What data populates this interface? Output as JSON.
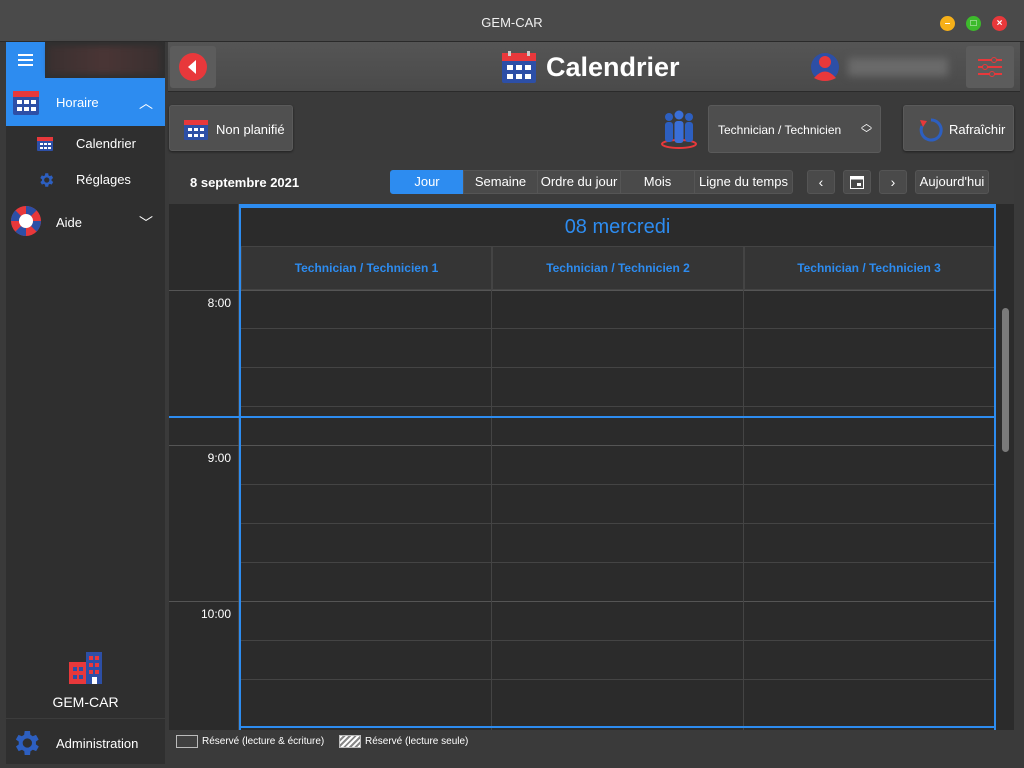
{
  "window": {
    "title": "GEM-CAR"
  },
  "sidebar": {
    "items": [
      {
        "label": "Horaire",
        "icon": "calendar-icon",
        "expanded": true
      },
      {
        "label": "Calendrier",
        "icon": "calendar-icon"
      },
      {
        "label": "Réglages",
        "icon": "gear-icon"
      },
      {
        "label": "Aide",
        "icon": "lifebuoy-icon",
        "expanded": false
      }
    ],
    "brand": "GEM-CAR",
    "admin": "Administration"
  },
  "header": {
    "title": "Calendrier"
  },
  "toolbar": {
    "unplanned_label": "Non planifié",
    "resource_select": "Technician / Technicien",
    "refresh_label": "Rafraîchir"
  },
  "calendar": {
    "date": "8 septembre 2021",
    "views": [
      "Jour",
      "Semaine",
      "Ordre du jour",
      "Mois",
      "Ligne du temps"
    ],
    "active_view": "Jour",
    "prev": "‹",
    "next": "›",
    "today_label": "Aujourd'hui",
    "day_label": "08 mercredi",
    "resources": [
      "Technician / Technicien 1",
      "Technician / Technicien 2",
      "Technician / Technicien 3"
    ],
    "hours": [
      "8:00",
      "9:00",
      "10:00"
    ]
  },
  "legend": {
    "read_write": "Réservé (lecture & écriture)",
    "read_only": "Réservé (lecture seule)"
  },
  "colors": {
    "accent": "#2d8cf0",
    "danger": "#e8383b",
    "bg": "#2b2b2b"
  }
}
